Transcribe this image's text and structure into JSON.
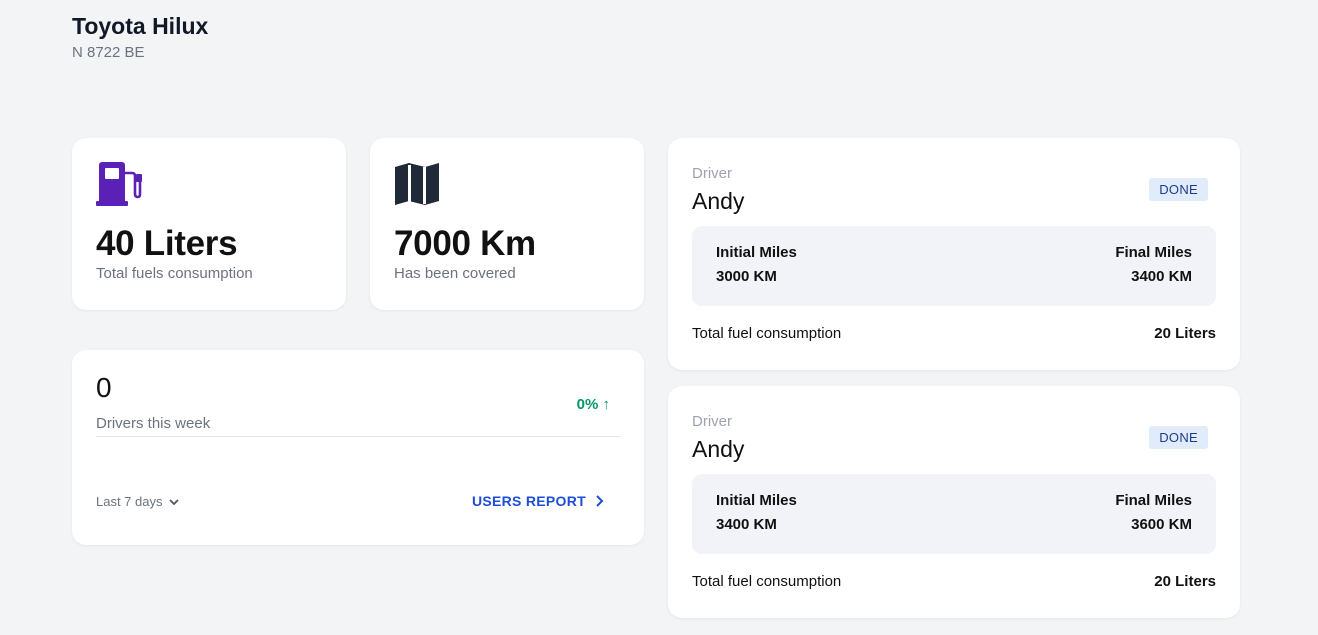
{
  "vehicle": {
    "name": "Toyota Hilux",
    "plate": "N 8722 BE"
  },
  "stats": {
    "fuel": {
      "icon": "fuel-pump-icon",
      "icon_color": "#5b21b6",
      "value": "40 Liters",
      "label": "Total fuels consumption"
    },
    "distance": {
      "icon": "map-icon",
      "icon_color": "#1f2937",
      "value": "7000 Km",
      "label": "Has been covered"
    }
  },
  "drivers": {
    "count": "0",
    "label": "Drivers this week",
    "change": "0% ↑",
    "change_color": "#059669",
    "period": "Last 7 days",
    "report_link": "USERS REPORT"
  },
  "trips": [
    {
      "role_label": "Driver",
      "driver": "Andy",
      "status": "DONE",
      "initial_label": "Initial Miles",
      "initial_value": "3000 KM",
      "final_label": "Final Miles",
      "final_value": "3400 KM",
      "fuel_label": "Total fuel consumption",
      "fuel_value": "20 Liters"
    },
    {
      "role_label": "Driver",
      "driver": "Andy",
      "status": "DONE",
      "initial_label": "Initial Miles",
      "initial_value": "3400 KM",
      "final_label": "Final Miles",
      "final_value": "3600 KM",
      "fuel_label": "Total fuel consumption",
      "fuel_value": "20 Liters"
    }
  ],
  "colors": {
    "background": "#f3f4f6",
    "card": "#ffffff",
    "link": "#1d4ed8",
    "badge_bg": "#e0ecfa",
    "badge_text": "#1e3a8a"
  }
}
